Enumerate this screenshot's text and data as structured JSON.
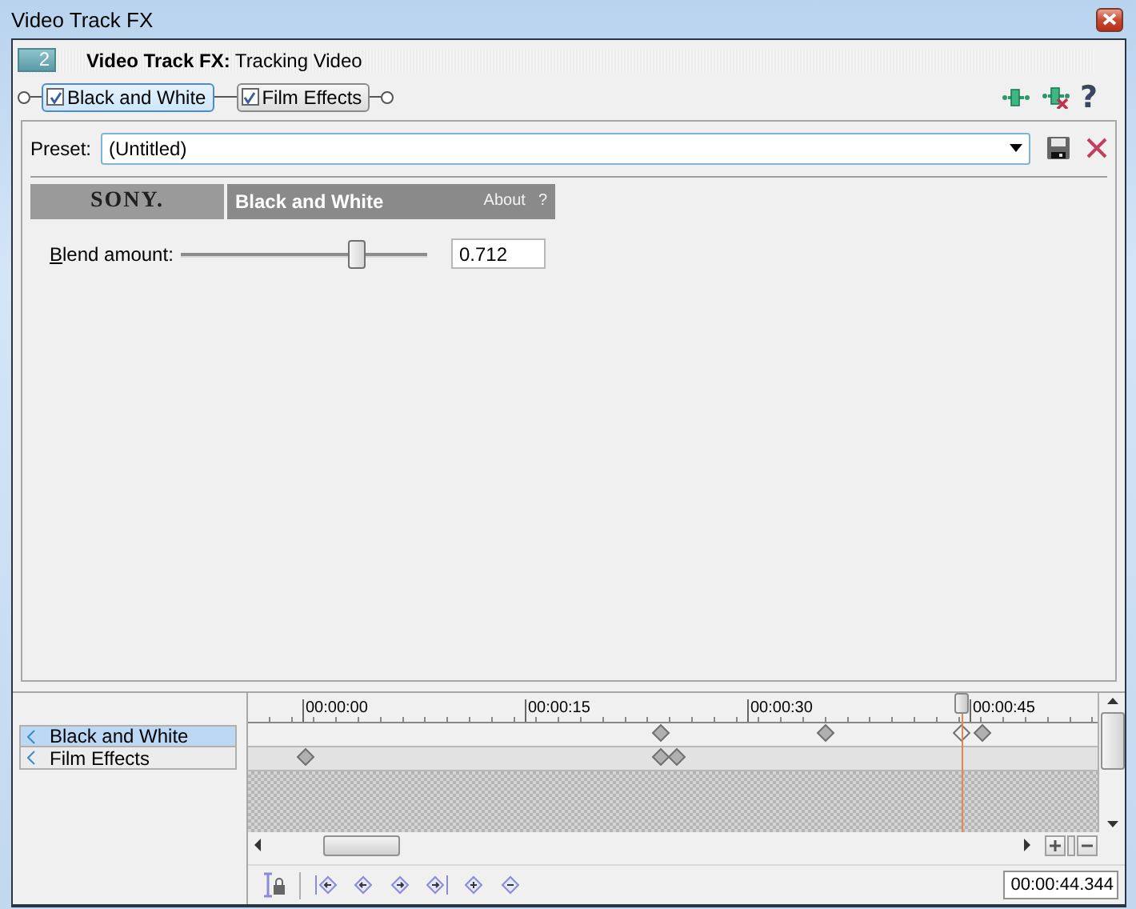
{
  "window": {
    "title": "Video Track FX"
  },
  "header": {
    "badge": "2",
    "title": "**Video Track FX:** Tracking Video"
  },
  "chain": [
    {
      "label": "Black and White",
      "checked": true,
      "selected": true
    },
    {
      "label": "Film Effects",
      "checked": true,
      "selected": false
    }
  ],
  "toolbar": {
    "help": "?"
  },
  "preset": {
    "label": "Preset:",
    "value": "(Untitled)"
  },
  "plugin": {
    "brand": "SONY.",
    "name": "Black and White",
    "about": "About",
    "help": "?"
  },
  "parameters": [
    {
      "label": "Blend amount:",
      "level": 0.712,
      "value": "0.712"
    }
  ],
  "timeline": {
    "ruler": [
      "00:00:00",
      "00:00:15",
      "00:00:30",
      "00:00:45"
    ],
    "tracks": [
      {
        "label": "Black and White",
        "selected": true,
        "keyframes": [
          {
            "level": 0.486,
            "selected": false
          },
          {
            "level": 0.679,
            "selected": false
          },
          {
            "level": 0.839,
            "selected": true
          },
          {
            "level": 0.864,
            "selected": false
          }
        ]
      },
      {
        "label": "Film Effects",
        "selected": false,
        "keyframes": [
          {
            "level": 0.068,
            "selected": false
          },
          {
            "level": 0.486,
            "selected": false
          },
          {
            "level": 0.505,
            "selected": false
          }
        ]
      }
    ],
    "cursor": {
      "level": 0.839
    },
    "time": "00:00:44.344"
  }
}
